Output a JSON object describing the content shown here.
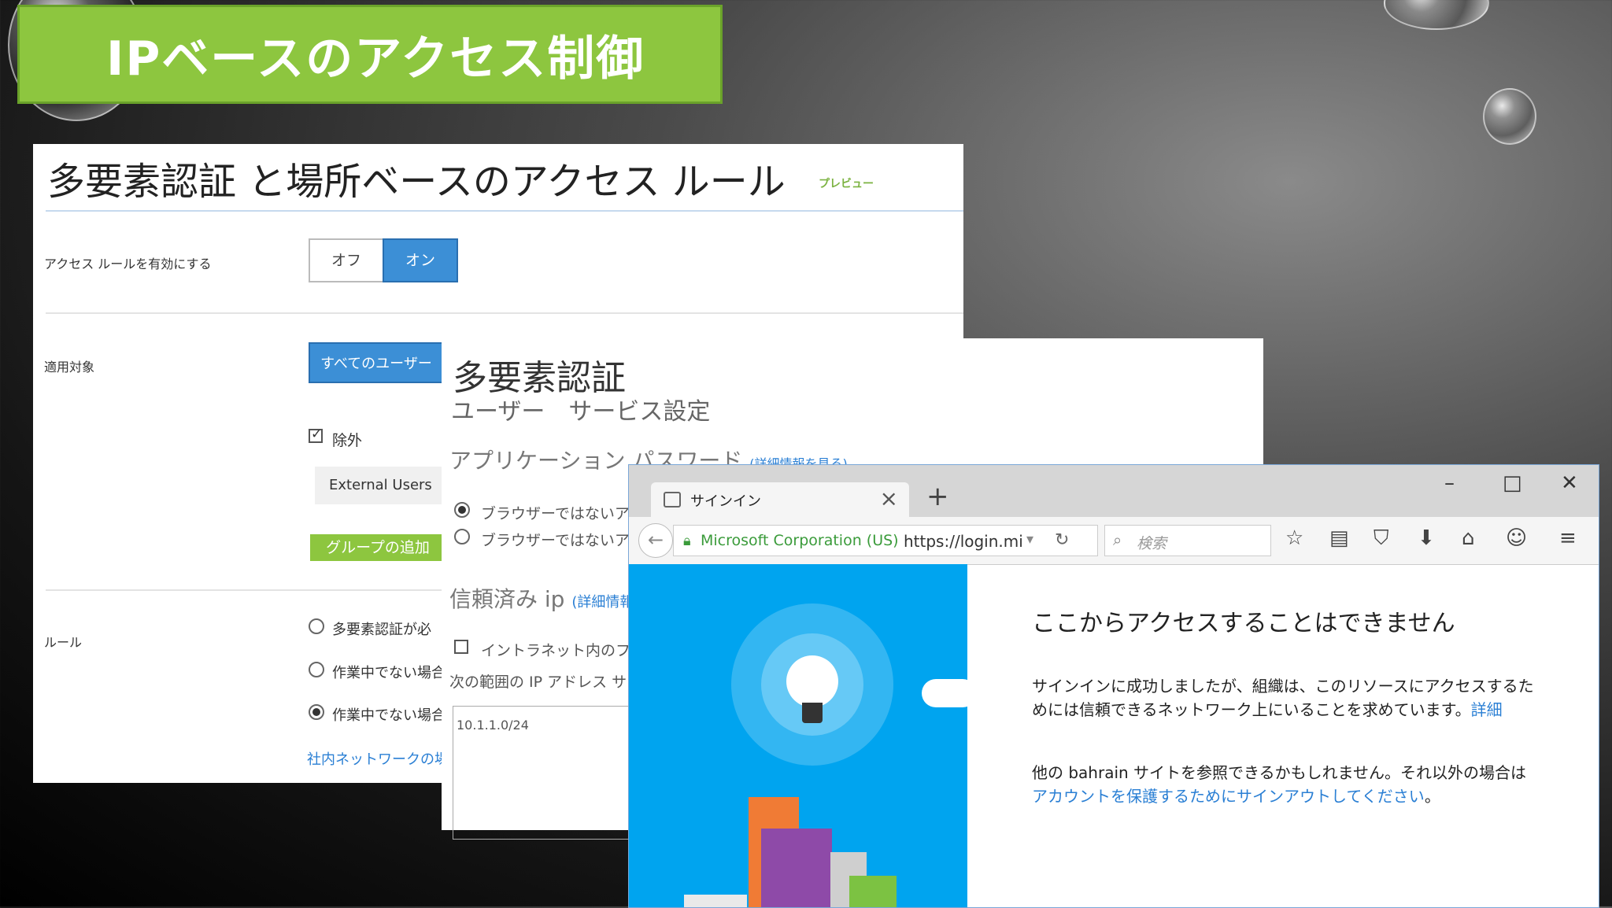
{
  "slide_title": "IPベースのアクセス制御",
  "panel1": {
    "title": "多要素認証 と場所ベースのアクセス ルール",
    "preview_badge": "プレビュー",
    "enable_label": "アクセス ルールを有効にする",
    "toggle_off": "オフ",
    "toggle_on": "オン",
    "applies_label": "適用対象",
    "all_users": "すべてのユーザー",
    "exclude_label": "除外",
    "external_users": "External Users",
    "add_group": "グループの追加",
    "rules_label": "ルール",
    "rule1": "多要素認証が必",
    "rule2": "作業中でない場合",
    "rule3": "作業中でない場合",
    "internal_network_link": "社内ネットワークの場"
  },
  "panel2": {
    "title": "多要素認証",
    "subtitle": "ユーザー　サービス設定",
    "app_password": "アプリケーション パスワード",
    "more_info": "(詳細情報を見る)",
    "opt1": "ブラウザーではないア",
    "opt2": "ブラウザーではないア",
    "trusted_ip": "信頼済み ip",
    "trusted_more": "(詳細情報",
    "intranet": "イントラネット内のフェデ",
    "ip_range": "次の範囲の IP アドレス サブ",
    "ip_value": "10.1.1.0/24"
  },
  "browser": {
    "tab_title": "サインイン",
    "company": "Microsoft Corporation (US)",
    "url": "https://login.mi",
    "search_placeholder": "検索",
    "heading": "ここからアクセスすることはできません",
    "body1": "サインインに成功しましたが、組織は、このリソースにアクセスするためには信頼できるネットワーク上にいることを求めています。",
    "details_link": "詳細",
    "body2": "他の bahrain サイトを参照できるかもしれません。それ以外の場合は",
    "signout_link": "アカウントを保護するためにサインアウトしてください",
    "body2_end": "。"
  },
  "colors": {
    "accent_green": "#8dc63f",
    "accent_blue": "#3c8fd6",
    "sky": "#00a4ef"
  }
}
